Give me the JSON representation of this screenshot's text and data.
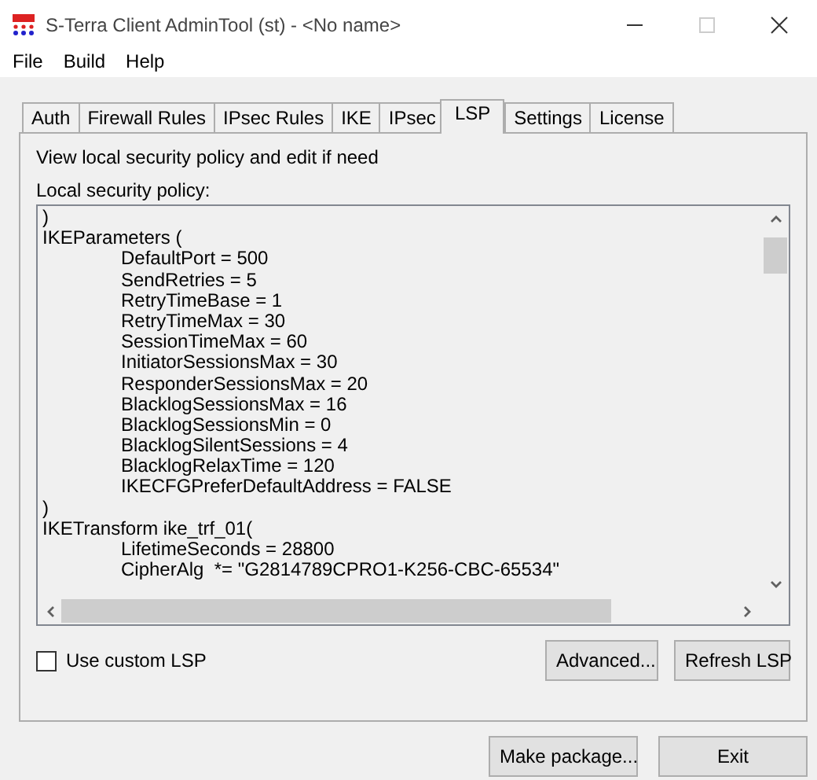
{
  "window": {
    "title": "S-Terra Client AdminTool (st) - <No name>"
  },
  "menu": [
    "File",
    "Build",
    "Help"
  ],
  "tabs": [
    {
      "label": "Auth",
      "selected": false
    },
    {
      "label": "Firewall Rules",
      "selected": false
    },
    {
      "label": "IPsec Rules",
      "selected": false
    },
    {
      "label": "IKE",
      "selected": false
    },
    {
      "label": "IPsec",
      "selected": false
    },
    {
      "label": "LSP",
      "selected": true
    },
    {
      "label": "Settings",
      "selected": false
    },
    {
      "label": "License",
      "selected": false
    }
  ],
  "description": "View local security policy and edit if need",
  "policy": {
    "label": "Local security policy:",
    "lines": [
      ")",
      "IKEParameters (",
      "\tDefaultPort = 500",
      "\tSendRetries = 5",
      "\tRetryTimeBase = 1",
      "\tRetryTimeMax = 30",
      "\tSessionTimeMax = 60",
      "\tInitiatorSessionsMax = 30",
      "\tResponderSessionsMax = 20",
      "\tBlacklogSessionsMax = 16",
      "\tBlacklogSessionsMin = 0",
      "\tBlacklogSilentSessions = 4",
      "\tBlacklogRelaxTime = 120",
      "\tIKECFGPreferDefaultAddress = FALSE",
      ")",
      "IKETransform ike_trf_01(",
      "\tLifetimeSeconds = 28800",
      "\tCipherAlg  *= \"G2814789CPRO1-K256-CBC-65534\""
    ]
  },
  "custom_lsp": {
    "label": "Use custom LSP",
    "checked": false
  },
  "panel_buttons": [
    "Advanced...",
    "Refresh LSP"
  ],
  "footer_buttons": [
    "Make package...",
    "Exit"
  ]
}
